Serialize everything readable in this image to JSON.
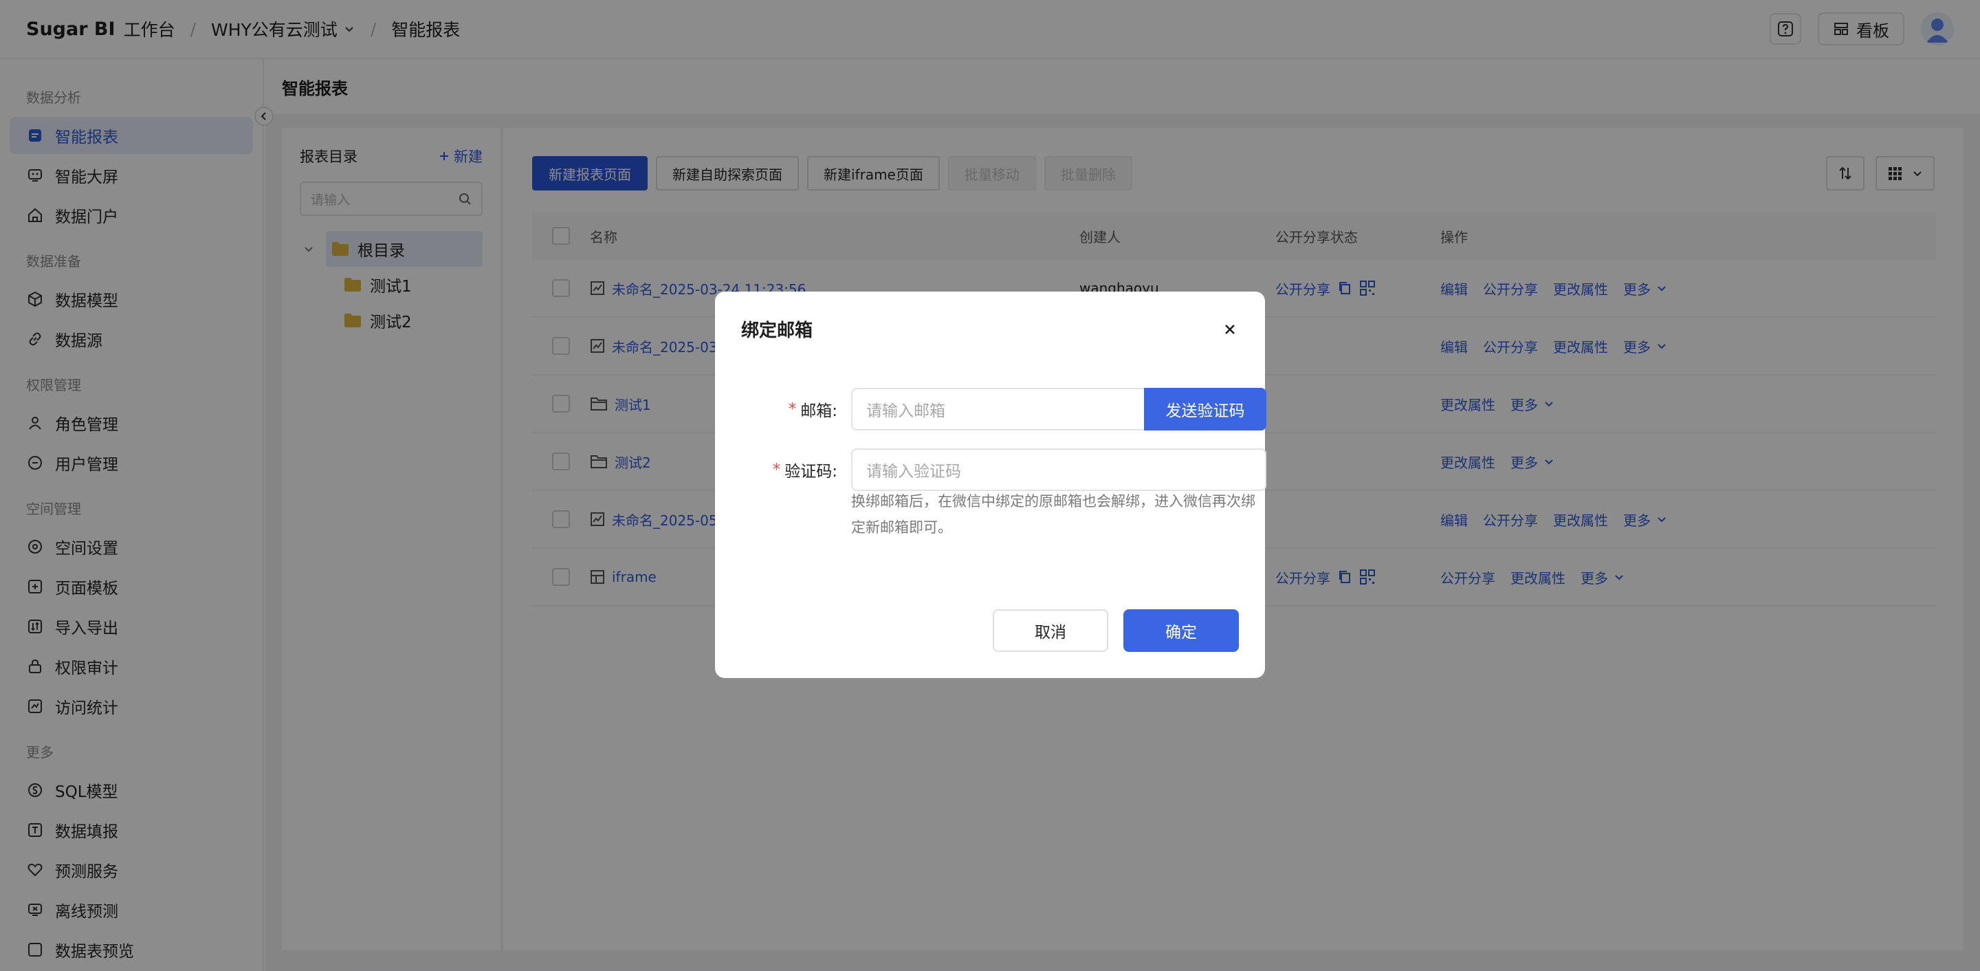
{
  "header": {
    "brand": "Sugar BI",
    "brand_sub": "工作台",
    "project": "WHY公有云测试",
    "current": "智能报表",
    "board_label": "看板"
  },
  "sidebar": {
    "sections": [
      {
        "title": "数据分析",
        "items": [
          {
            "label": "智能报表",
            "icon": "report-icon",
            "active": true
          },
          {
            "label": "智能大屏",
            "icon": "screen-icon"
          },
          {
            "label": "数据门户",
            "icon": "home-icon"
          }
        ]
      },
      {
        "title": "数据准备",
        "items": [
          {
            "label": "数据模型",
            "icon": "cube-icon"
          },
          {
            "label": "数据源",
            "icon": "link-icon"
          }
        ]
      },
      {
        "title": "权限管理",
        "items": [
          {
            "label": "角色管理",
            "icon": "user-icon"
          },
          {
            "label": "用户管理",
            "icon": "users-icon"
          }
        ]
      },
      {
        "title": "空间管理",
        "items": [
          {
            "label": "空间设置",
            "icon": "settings-icon"
          },
          {
            "label": "页面模板",
            "icon": "template-icon"
          },
          {
            "label": "导入导出",
            "icon": "import-export-icon"
          },
          {
            "label": "权限审计",
            "icon": "lock-icon"
          },
          {
            "label": "访问统计",
            "icon": "stats-icon"
          }
        ]
      },
      {
        "title": "更多",
        "items": [
          {
            "label": "SQL模型",
            "icon": "sql-icon"
          },
          {
            "label": "数据填报",
            "icon": "form-icon"
          },
          {
            "label": "预测服务",
            "icon": "heart-icon"
          },
          {
            "label": "离线预测",
            "icon": "offline-icon"
          },
          {
            "label": "数据表预览",
            "icon": "table-icon"
          }
        ]
      }
    ]
  },
  "page": {
    "title": "智能报表"
  },
  "tree": {
    "title": "报表目录",
    "new_label": "新建",
    "search_placeholder": "请输入",
    "root": "根目录",
    "children": [
      "测试1",
      "测试2"
    ]
  },
  "toolbar": {
    "new_report": "新建报表页面",
    "new_explore": "新建自助探索页面",
    "new_iframe": "新建iframe页面",
    "batch_move": "批量移动",
    "batch_delete": "批量删除"
  },
  "table": {
    "columns": [
      "名称",
      "创建人",
      "公开分享状态",
      "操作"
    ],
    "rows": [
      {
        "type": "report",
        "name": "未命名_2025-03-24 11:23:56",
        "creator": "wanghaoyu",
        "share": "公开分享",
        "ops": [
          "编辑",
          "公开分享",
          "更改属性",
          "更多"
        ]
      },
      {
        "type": "report",
        "name": "未命名_2025-03",
        "creator": "",
        "share": "",
        "ops": [
          "编辑",
          "公开分享",
          "更改属性",
          "更多"
        ]
      },
      {
        "type": "folder",
        "name": "测试1",
        "creator": "",
        "share": "",
        "ops": [
          "更改属性",
          "更多"
        ]
      },
      {
        "type": "folder",
        "name": "测试2",
        "creator": "",
        "share": "",
        "ops": [
          "更改属性",
          "更多"
        ]
      },
      {
        "type": "report",
        "name": "未命名_2025-05",
        "creator": "",
        "share": "",
        "ops": [
          "编辑",
          "公开分享",
          "更改属性",
          "更多"
        ]
      },
      {
        "type": "iframe",
        "name": "iframe",
        "creator": "",
        "share": "公开分享",
        "ops": [
          "公开分享",
          "更改属性",
          "更多"
        ]
      }
    ]
  },
  "modal": {
    "title": "绑定邮箱",
    "email_label": "邮箱:",
    "email_placeholder": "请输入邮箱",
    "send_code": "发送验证码",
    "code_label": "验证码:",
    "code_placeholder": "请输入验证码",
    "hint": "换绑邮箱后，在微信中绑定的原邮箱也会解绑，进入微信再次绑定新邮箱即可。",
    "cancel": "取消",
    "ok": "确定"
  },
  "colors": {
    "primary": "#2a56d8",
    "link": "#2f5bd9",
    "required": "#e5484d"
  }
}
